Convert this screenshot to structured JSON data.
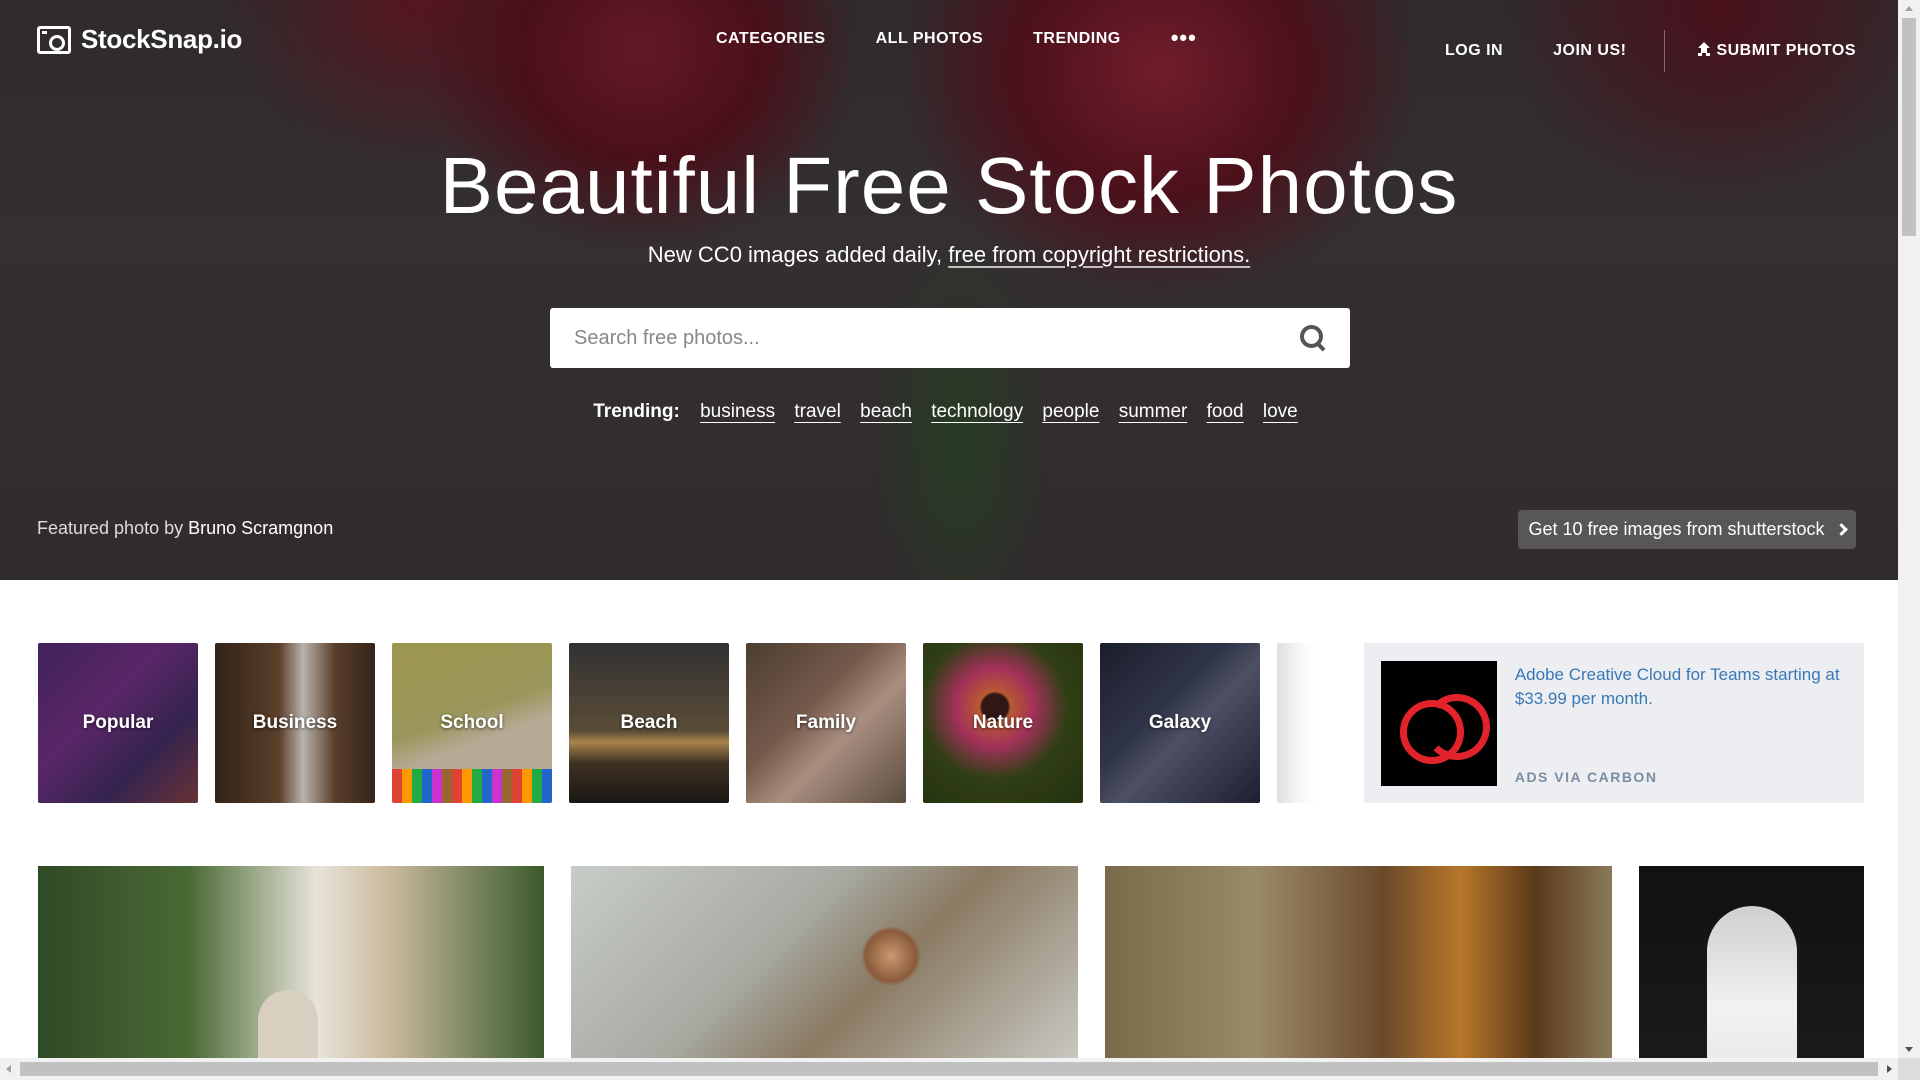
{
  "logo": {
    "text": "StockSnap.io",
    "icon": "camera-icon"
  },
  "nav": {
    "categories": "CATEGORIES",
    "all_photos": "ALL PHOTOS",
    "trending": "TRENDING",
    "more": "•••",
    "log_in": "LOG IN",
    "join": "JOIN US!",
    "submit": "SUBMIT PHOTOS"
  },
  "hero": {
    "title": "Beautiful Free Stock Photos",
    "subtitle_prefix": "New CC0 images added daily,",
    "subtitle_link": "free from copyright restrictions.",
    "search_placeholder": "Search free photos...",
    "trending_label": "Trending:",
    "trending_tags": [
      "business",
      "travel",
      "beach",
      "technology",
      "people",
      "summer",
      "food",
      "love"
    ],
    "credit_prefix": "Featured photo by",
    "credit_name": "Bruno Scramgnon",
    "shutterstock_button": "Get 10 free images from shutterstock"
  },
  "categories": [
    "Popular",
    "Business",
    "School",
    "Beach",
    "Family",
    "Nature",
    "Galaxy"
  ],
  "ad": {
    "copy": "Adobe Creative Cloud for Teams starting at $33.99 per month.",
    "via": "ADS VIA CARBON",
    "brand_color": "#e3232b"
  },
  "colors": {
    "link": "#3a78b5",
    "ad_background": "#eceef1"
  }
}
